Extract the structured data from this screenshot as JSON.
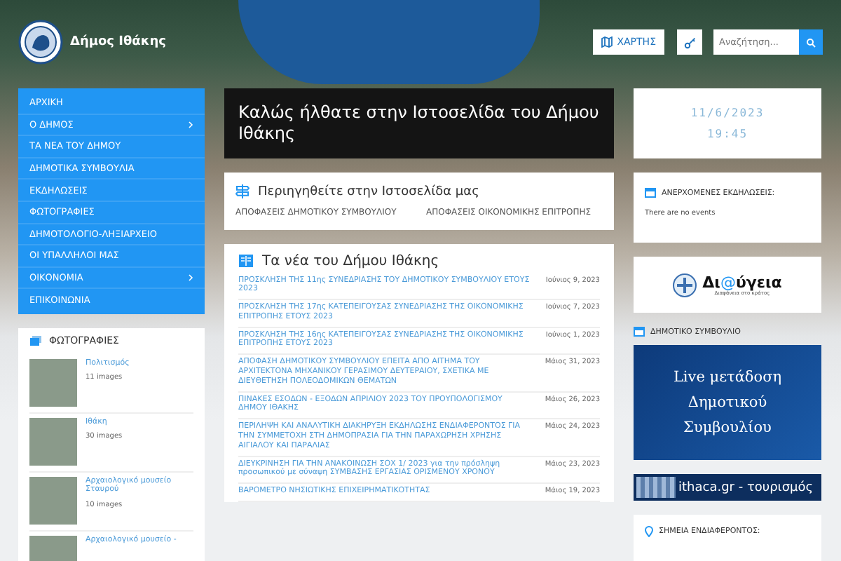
{
  "header": {
    "site_title": "Δήμος Ιθάκης",
    "map_button": "ΧΑΡΤΗΣ",
    "search": {
      "placeholder": "Αναζήτηση..."
    }
  },
  "menu": [
    {
      "label": "ΑΡΧΙΚΗ",
      "has_submenu": false
    },
    {
      "label": "Ο ΔΗΜΟΣ",
      "has_submenu": true
    },
    {
      "label": "ΤΑ ΝΕΑ ΤΟΥ ΔΗΜΟΥ",
      "has_submenu": false
    },
    {
      "label": "ΔΗΜΟΤΙΚΑ ΣΥΜΒΟΥΛΙΑ",
      "has_submenu": false
    },
    {
      "label": "ΕΚΔΗΛΩΣΕΙΣ",
      "has_submenu": false
    },
    {
      "label": "ΦΩΤΟΓΡΑΦΙΕΣ",
      "has_submenu": false
    },
    {
      "label": "ΔΗΜΟΤΟΛΟΓΙΟ-ΛΗΞΙΑΡΧΕΙΟ",
      "has_submenu": false
    },
    {
      "label": "ΟΙ ΥΠΑΛΛΗΛΟΙ ΜΑΣ",
      "has_submenu": false
    },
    {
      "label": "ΟΙΚΟΝΟΜΙΑ",
      "has_submenu": true
    },
    {
      "label": "ΕΠΙΚΟΙΝΩΝΙΑ",
      "has_submenu": false
    }
  ],
  "photos": {
    "title": "ΦΩΤΟΓΡΑΦΙΕΣ",
    "albums": [
      {
        "title": "Πολιτισμός",
        "count": "11 images"
      },
      {
        "title": "Ιθάκη",
        "count": "30 images"
      },
      {
        "title": "Αρχαιολογικό μουσείο Σταυρού",
        "count": "10 images"
      },
      {
        "title": "Αρχαιολογικό μουσείο -"
      }
    ]
  },
  "welcome": {
    "title": "Καλώς ήλθατε στην Ιστοσελίδα του Δήμου Ιθάκης"
  },
  "navigate": {
    "title": "Περιηγηθείτε στην Ιστοσελίδα μας",
    "links": [
      "ΑΠΟΦΑΣΕΙΣ ΔΗΜΟΤΙΚΟΥ ΣΥΜΒΟΥΛΙΟΥ",
      "ΑΠΟΦΑΣΕΙΣ ΟΙΚΟΝΟΜΙΚΗΣ ΕΠΙΤΡΟΠΗΣ"
    ]
  },
  "news": {
    "title": "Τα νέα του Δήμου Ιθάκης",
    "items": [
      {
        "title": "ΠΡΟΣΚΛΗΣΗ ΤΗΣ 11ης ΣΥΝΕΔΡΙΑΣΗΣ ΤΟΥ ΔΗΜΟΤΙΚΟΥ ΣΥΜΒΟΥΛΙΟΥ ΕΤΟΥΣ 2023",
        "date": "Ιούνιος 9, 2023"
      },
      {
        "title": "ΠΡΟΣΚΛΗΣΗ ΤΗΣ 17ης ΚΑΤΕΠΕΙΓΟΥΣΑΣ ΣΥΝΕΔΡΙΑΣΗΣ ΤΗΣ ΟΙΚΟΝΟΜΙΚΗΣ ΕΠΙΤΡΟΠΗΣ ΕΤΟΥΣ 2023",
        "date": "Ιούνιος 7, 2023"
      },
      {
        "title": "ΠΡΟΣΚΛΗΣΗ ΤΗΣ 16ης ΚΑΤΕΠΕΙΓΟΥΣΑΣ ΣΥΝΕΔΡΙΑΣΗΣ ΤΗΣ ΟΙΚΟΝΟΜΙΚΗΣ ΕΠΙΤΡΟΠΗΣ ΕΤΟΥΣ 2023",
        "date": "Ιούνιος 1, 2023"
      },
      {
        "title": "ΑΠΟΦΑΣΗ ΔΗΜΟΤΙΚΟΥ ΣΥΜΒΟΥΛΙΟΥ ΕΠΕΙΤΑ ΑΠΟ ΑΙΤΗΜΑ ΤΟΥ ΑΡΧΙΤΕΚΤΟΝΑ ΜΗΧΑΝΙΚΟΥ ΓΕΡΑΣΙΜΟΥ ΔΕΥΤΕΡΑΙΟΥ, ΣΧΕΤΙΚΑ ΜΕ ΔΙΕΥΘΕΤΗΣΗ ΠΟΛΕΟΔΟΜΙΚΩΝ ΘΕΜΑΤΩΝ",
        "date": "Μάιος 31, 2023"
      },
      {
        "title": "ΠΙΝΑΚΕΣ ΕΣΟΔΩΝ - ΕΞΟΔΩΝ ΑΠΡΙΛΙΟΥ 2023 ΤΟΥ ΠΡΟΥΠΟΛΟΓΙΣΜΟΥ ΔΗΜΟΥ ΙΘΑΚΗΣ",
        "date": "Μάιος 26, 2023"
      },
      {
        "title": "ΠΕΡΙΛΗΨΗ ΚΑΙ ΑΝΑΛΥΤΙΚΗ ΔΙΑΚΗΡΥΞΗ ΕΚΔΗΛΩΣΗΣ ΕΝΔΙΑΦΕΡΟΝΤΟΣ ΓΙΑ ΤΗΝ ΣΥΜΜΕΤΟΧΗ ΣΤΗ ΔΗΜΟΠΡΑΣΙΑ ΓΙΑ ΤΗΝ ΠΑΡΑΧΩΡΗΣΗ ΧΡΗΣΗΣ ΑΙΓΙΑΛΟΥ ΚΑΙ ΠΑΡΑΛΙΑΣ",
        "date": "Μάιος 24, 2023"
      },
      {
        "title": "ΔΙΕΥΚΡΙΝΗΣΗ ΓΙΑ ΤΗΝ ΑΝΑΚΟΙΝΩΣΗ ΣΟΧ 1/ 2023 για την πρόσληψη προσωπικού με σύναψη ΣΥΜΒΑΣΗΣ ΕΡΓΑΣΙΑΣ ΟΡΙΣΜΕΝΟΥ ΧΡΟΝΟΥ",
        "date": "Μάιος 23, 2023"
      },
      {
        "title": "ΒΑΡΟΜΕΤΡΟ ΝΗΣΙΩΤΙΚΗΣ ΕΠΙΧΕΙΡΗΜΑΤΙΚΟΤΗΤΑΣ",
        "date": "Μάιος 19, 2023"
      }
    ]
  },
  "clock": {
    "date": "11/6/2023",
    "time": "19:45"
  },
  "events": {
    "title": "ΑΝΕΡΧΟΜΕΝΕΣ ΕΚΔΗΛΩΣΕΙΣ:",
    "empty_text": "There are no events"
  },
  "diavgeia": {
    "name_start": "Δι",
    "name_at": "@",
    "name_end": "ύγεια",
    "tagline": "Διαφάνεια στο κράτος"
  },
  "council": {
    "title": "ΔΗΜΟΤΙΚΟ ΣΥΜΒΟΥΛΙΟ",
    "live_banner": "Live μετάδοση Δημοτικού Συμβουλίου"
  },
  "tourism_banner": "ithaca.gr - τουρισμός",
  "points": {
    "title": "ΣΗΜΕΙΑ ΕΝΔΙΑΦΕΡΟΝΤΟΣ:"
  }
}
